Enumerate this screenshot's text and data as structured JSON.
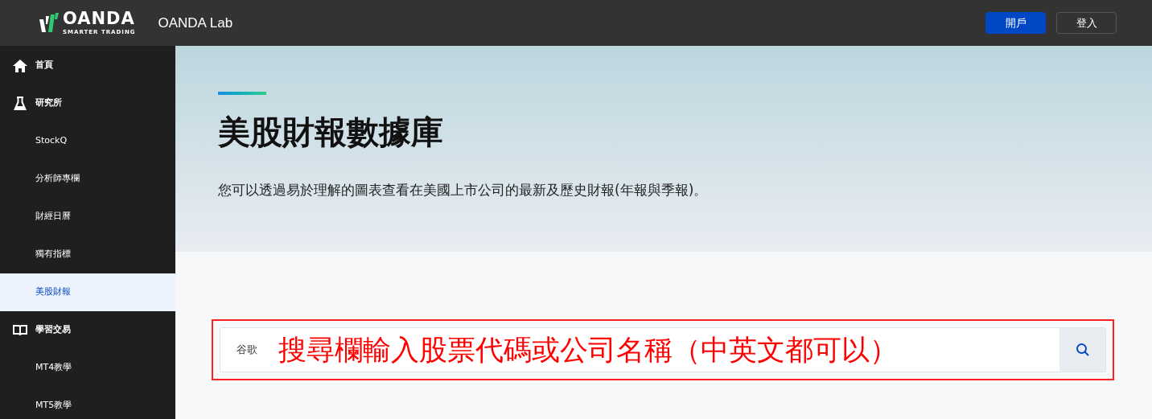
{
  "header": {
    "logo_word": "OANDA",
    "logo_tagline": "SMARTER TRADING",
    "site_title": "OANDA Lab",
    "buttons": [
      {
        "label": "開戶",
        "kind": "primary"
      },
      {
        "label": "登入",
        "kind": "outline"
      }
    ]
  },
  "sidebar": {
    "items": [
      {
        "label": "首頁",
        "kind": "section",
        "selected": false
      },
      {
        "label": "研究所",
        "kind": "section",
        "selected": false
      },
      {
        "label": "StockQ",
        "kind": "sub",
        "selected": false
      },
      {
        "label": "分析師專欄",
        "kind": "sub",
        "selected": false
      },
      {
        "label": "財經日曆",
        "kind": "sub",
        "selected": false
      },
      {
        "label": "獨有指標",
        "kind": "sub",
        "selected": false
      },
      {
        "label": "美股財報",
        "kind": "sub",
        "selected": true
      },
      {
        "label": "學習交易",
        "kind": "section",
        "selected": false
      },
      {
        "label": "MT4教學",
        "kind": "sub",
        "selected": false
      },
      {
        "label": "MT5教學",
        "kind": "sub",
        "selected": false
      }
    ]
  },
  "hero": {
    "title": "美股財報數據庫",
    "description": "您可以透過易於理解的圖表查看在美國上市公司的最新及歷史財報(年報與季報)。"
  },
  "search": {
    "value": "谷歌",
    "annotation": "搜尋欄輸入股票代碼或公司名稱（中英文都可以）"
  }
}
